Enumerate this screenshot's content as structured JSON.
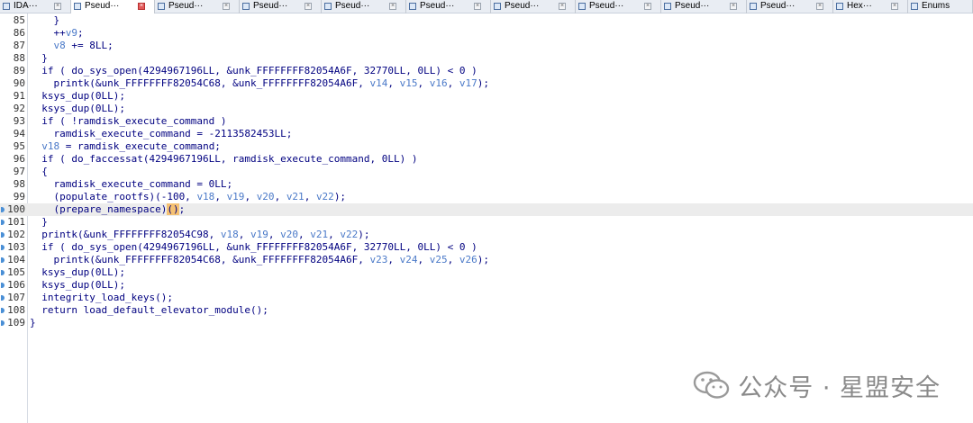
{
  "tabs": [
    {
      "label": "IDA···",
      "active": false
    },
    {
      "label": "Pseud···",
      "active": true
    },
    {
      "label": "Pseud···",
      "active": false
    },
    {
      "label": "Pseud···",
      "active": false
    },
    {
      "label": "Pseud···",
      "active": false
    },
    {
      "label": "Pseud···",
      "active": false
    },
    {
      "label": "Pseud···",
      "active": false
    },
    {
      "label": "Pseud···",
      "active": false
    },
    {
      "label": "Pseud···",
      "active": false
    },
    {
      "label": "Pseud···",
      "active": false
    },
    {
      "label": "Hex···",
      "active": false
    },
    {
      "label": "Enums",
      "active": false
    }
  ],
  "code_lines": [
    {
      "n": "85",
      "text": "    }"
    },
    {
      "n": "86",
      "text": "    ++v9;"
    },
    {
      "n": "87",
      "text": "    v8 += 8LL;"
    },
    {
      "n": "88",
      "text": "  }"
    },
    {
      "n": "89",
      "text": "  if ( do_sys_open(4294967196LL, &unk_FFFFFFFF82054A6F, 32770LL, 0LL) < 0 )"
    },
    {
      "n": "90",
      "text": "    printk(&unk_FFFFFFFF82054C68, &unk_FFFFFFFF82054A6F, v14, v15, v16, v17);"
    },
    {
      "n": "91",
      "text": "  ksys_dup(0LL);"
    },
    {
      "n": "92",
      "text": "  ksys_dup(0LL);"
    },
    {
      "n": "93",
      "text": "  if ( !ramdisk_execute_command )"
    },
    {
      "n": "94",
      "text": "    ramdisk_execute_command = -2113582453LL;"
    },
    {
      "n": "95",
      "text": "  v18 = ramdisk_execute_command;"
    },
    {
      "n": "96",
      "text": "  if ( do_faccessat(4294967196LL, ramdisk_execute_command, 0LL) )"
    },
    {
      "n": "97",
      "text": "  {"
    },
    {
      "n": "98",
      "text": "    ramdisk_execute_command = 0LL;"
    },
    {
      "n": "99",
      "text": "    (populate_rootfs)(-100, v18, v19, v20, v21, v22);"
    },
    {
      "n": "100",
      "text": "    (prepare_namespace)();"
    },
    {
      "n": "101",
      "text": "  }"
    },
    {
      "n": "102",
      "text": "  printk(&unk_FFFFFFFF82054C98, v18, v19, v20, v21, v22);"
    },
    {
      "n": "103",
      "text": "  if ( do_sys_open(4294967196LL, &unk_FFFFFFFF82054A6F, 32770LL, 0LL) < 0 )"
    },
    {
      "n": "104",
      "text": "    printk(&unk_FFFFFFFF82054C68, &unk_FFFFFFFF82054A6F, v23, v24, v25, v26);"
    },
    {
      "n": "105",
      "text": "  ksys_dup(0LL);"
    },
    {
      "n": "106",
      "text": "  ksys_dup(0LL);"
    },
    {
      "n": "107",
      "text": "  integrity_load_keys();"
    },
    {
      "n": "108",
      "text": "  return load_default_elevator_module();"
    },
    {
      "n": "109",
      "text": "}"
    }
  ],
  "highlighted_line": "100",
  "breakpoint_lines": [
    "100",
    "101",
    "102",
    "103",
    "104",
    "105",
    "106",
    "107",
    "108",
    "109"
  ],
  "watermark": {
    "text": "公众号 · 星盟安全",
    "icon": "wechat-icon"
  },
  "colors": {
    "keyword_text": "#000080",
    "variable": "#4a79c8",
    "highlight_line": "#ececec",
    "paren_match": "#f5c173"
  }
}
